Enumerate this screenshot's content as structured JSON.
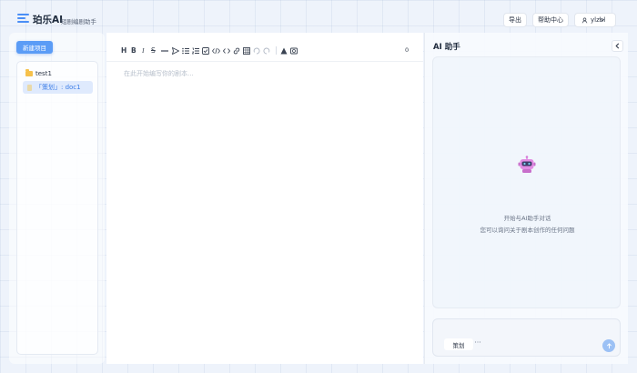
{
  "header": {
    "app_name": "珀乐AI",
    "subtitle": "短剧编剧助手",
    "export_label": "导出",
    "help_label": "帮助中心",
    "username": "ylzbl"
  },
  "sidebar": {
    "new_project_label": "新建项目",
    "folder": {
      "name": "test1"
    },
    "active_doc": {
      "label": "「策划」: doc1"
    }
  },
  "editor": {
    "toolbar_icons": [
      "heading-icon",
      "bold-icon",
      "italic-icon",
      "strikethrough-icon",
      "horizontal-rule-icon",
      "send-icon",
      "bullet-list-icon",
      "ordered-list-icon",
      "task-list-icon",
      "code-icon",
      "code-block-icon",
      "link-icon",
      "table-icon",
      "undo-icon",
      "redo-icon",
      "text-color-icon",
      "image-icon"
    ],
    "word_count": "0",
    "placeholder": "在此开始编写你的剧本..."
  },
  "ai_panel": {
    "title": "AI 助手",
    "welcome_line1": "开始与AI助手对话",
    "welcome_line2": "您可以询问关于剧本创作的任何问题",
    "mode_label": "策划",
    "more_label": "···"
  },
  "colors": {
    "accent": "#5b9cf6",
    "folder": "#f6c14b",
    "robot": "#d67ad8"
  }
}
